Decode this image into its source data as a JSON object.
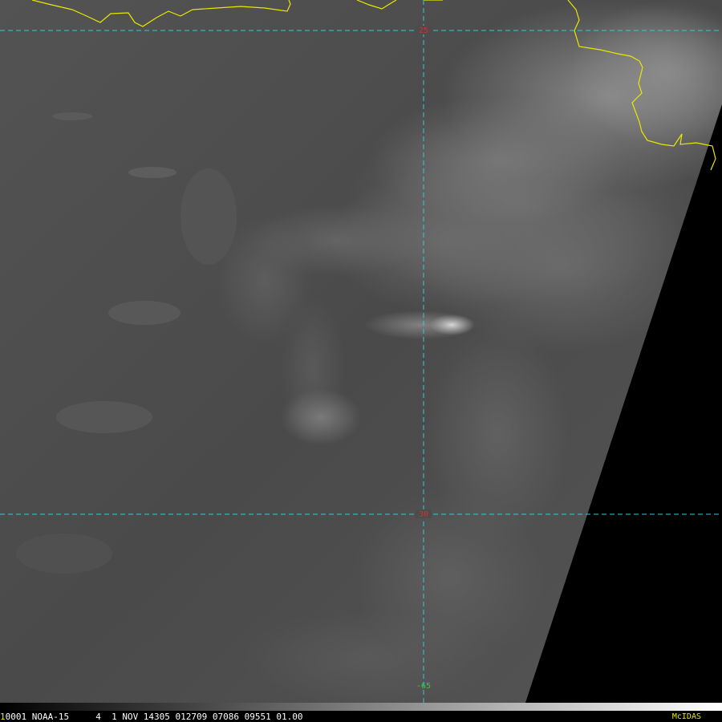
{
  "satellite_image": {
    "latitude_labels": [
      "25",
      "30"
    ],
    "longitude_labels": [
      "-65"
    ]
  },
  "status": {
    "frame_number": "1",
    "text": "0001 NOAA-15     4  1 NOV 14305 012709 07086 09551 01.00",
    "brand": "McIDAS"
  },
  "colors": {
    "coastline": "#e8e800",
    "grid": "#33cccc",
    "lat_label": "#cc3333",
    "lon_label": "#33cc33",
    "brand": "#e8e800"
  }
}
